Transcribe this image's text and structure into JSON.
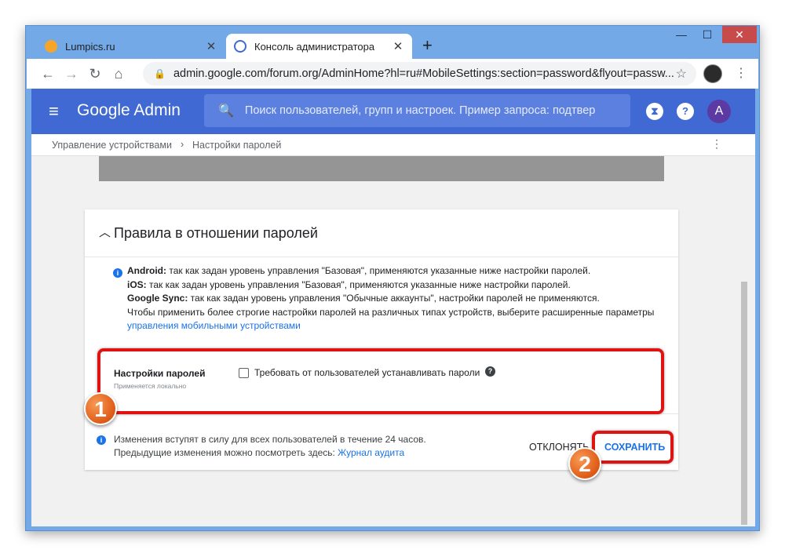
{
  "browser": {
    "tabs": [
      {
        "title": "Lumpics.ru",
        "favicon": "lumpics-favicon",
        "active": false
      },
      {
        "title": "Консоль администратора",
        "favicon": "admin-favicon",
        "active": true
      }
    ],
    "url": "admin.google.com/forum.org/AdminHome?hl=ru#MobileSettings:section=password&flyout=passw...",
    "window_buttons": {
      "minimize": "—",
      "maximize": "☐",
      "close": "✕"
    }
  },
  "header": {
    "brand": "Google Admin",
    "search_placeholder": "Поиск пользователей, групп и настроек. Пример запроса: подтвер",
    "avatar_letter": "A",
    "color": "#4169d4"
  },
  "breadcrumb": {
    "items": [
      "Управление устройствами",
      "Настройки паролей"
    ]
  },
  "section": {
    "title": "Правила в отношении паролей",
    "info": {
      "android_label": "Android:",
      "android_text": " так как задан уровень управления \"Базовая\", применяются указанные ниже настройки паролей.",
      "ios_label": "iOS:",
      "ios_text": " так как задан уровень управления \"Базовая\", применяются указанные ниже настройки паролей.",
      "sync_label": "Google Sync:",
      "sync_text": " так как задан уровень управления \"Обычные аккаунты\", настройки паролей не применяются.",
      "line4": "Чтобы применить более строгие настройки паролей на различных типах устройств, выберите расширенные параметры",
      "link": "управления мобильными устройствами"
    },
    "setting": {
      "label": "Настройки паролей",
      "sublabel": "Применяется локально",
      "checkbox_label": "Требовать от пользователей устанавливать пароли",
      "checked": false
    },
    "footer": {
      "line1": "Изменения вступят в силу для всех пользователей в течение 24 часов.",
      "line2": "Предыдущие изменения можно посмотреть здесь: ",
      "audit_link": "Журнал аудита",
      "discard": "ОТКЛОНЯТЬ",
      "save": "СОХРАНИТЬ"
    }
  },
  "annotations": {
    "badge1": "1",
    "badge2": "2",
    "highlight_color": "#e01313"
  }
}
